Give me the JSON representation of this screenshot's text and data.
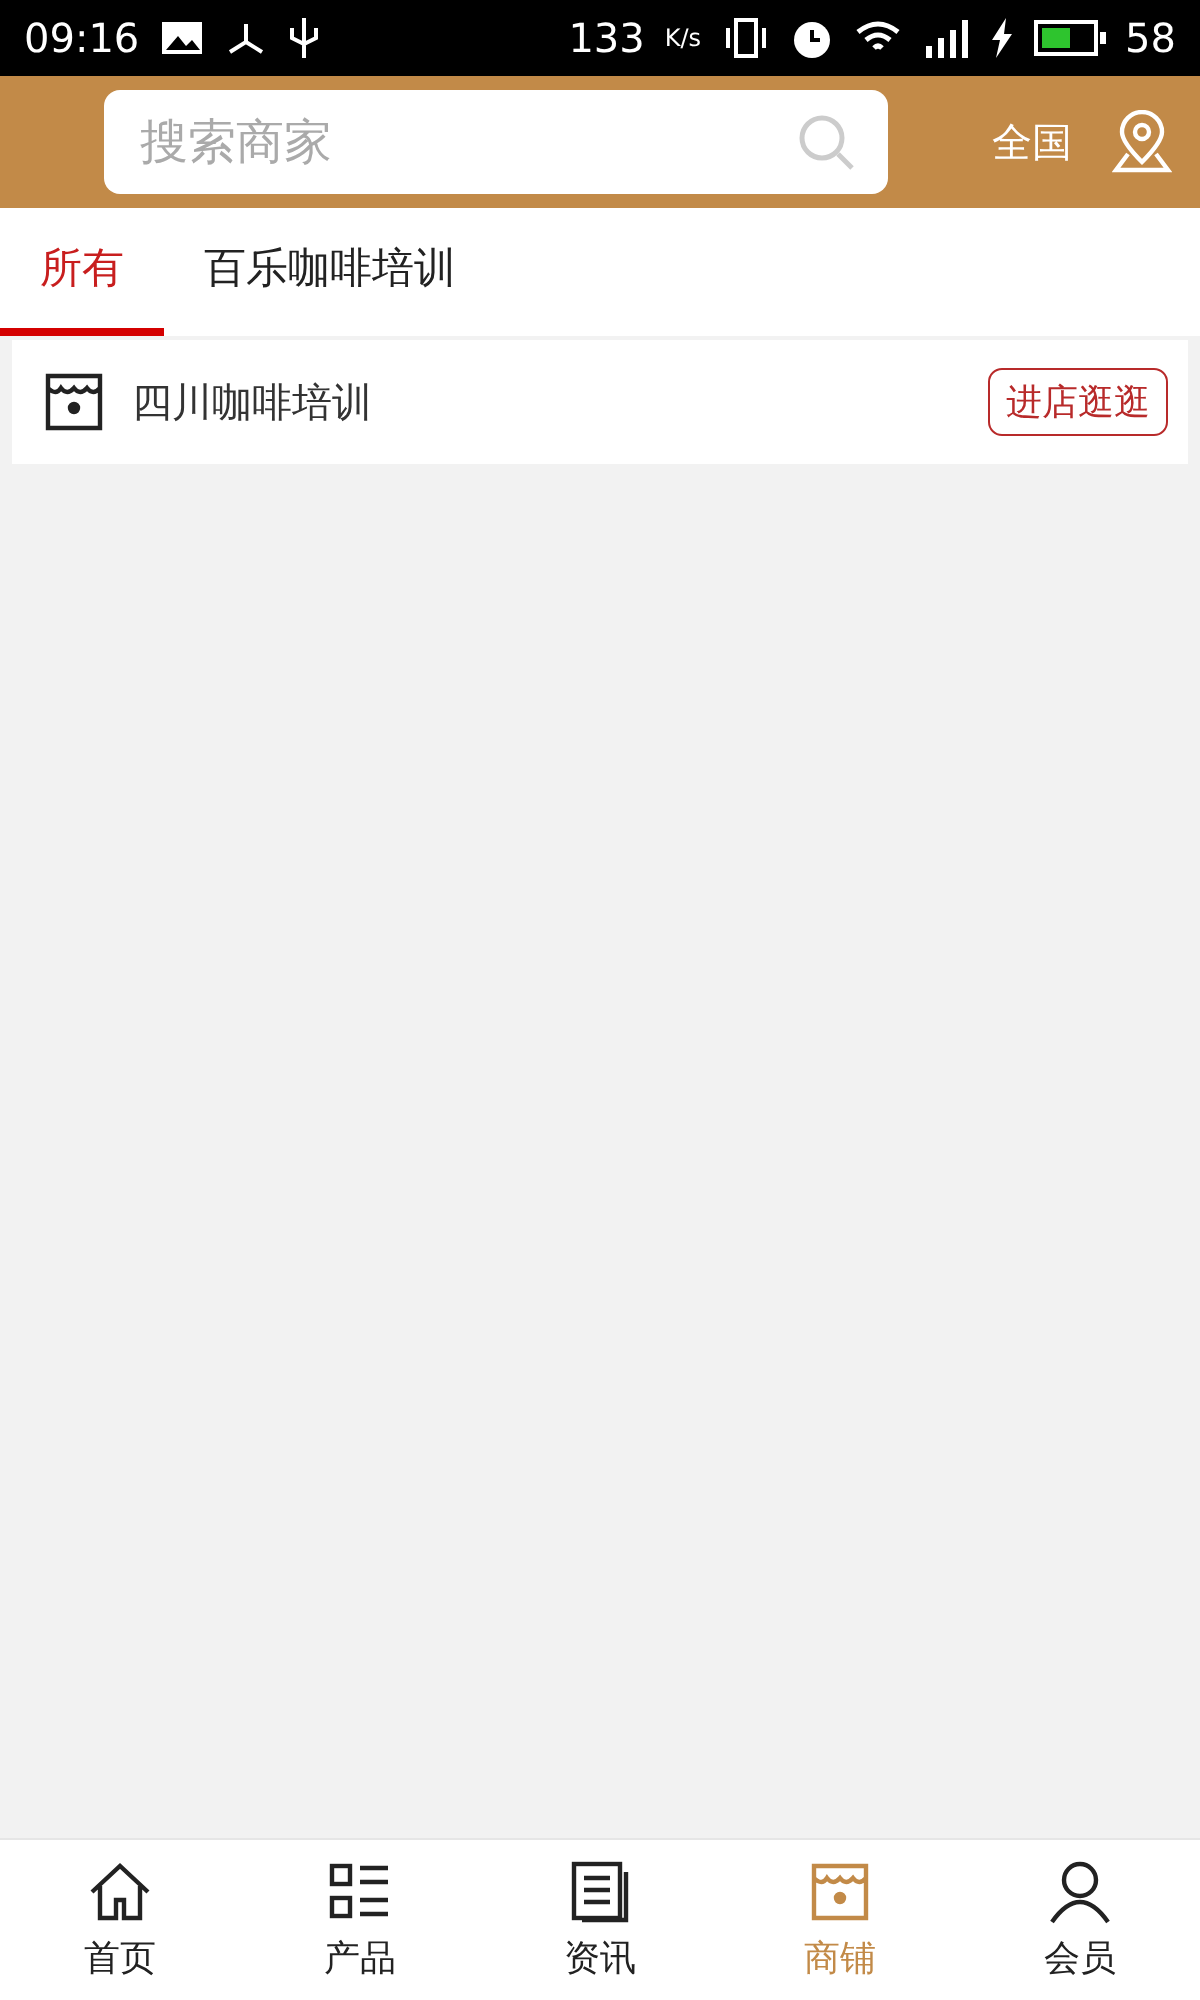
{
  "status_bar": {
    "time": "09:16",
    "speed": "133",
    "speed_unit": "K/s",
    "battery": "58"
  },
  "header": {
    "search": {
      "placeholder": "搜索商家"
    },
    "region": "全国"
  },
  "tabs": [
    {
      "label": "所有",
      "selected": true
    },
    {
      "label": "百乐咖啡培训",
      "selected": false
    }
  ],
  "shops": [
    {
      "name": "四川咖啡培训",
      "action": "进店逛逛"
    }
  ],
  "bottom_nav": [
    {
      "kind": "home",
      "label": "首页",
      "selected": false
    },
    {
      "kind": "list",
      "label": "产品",
      "selected": false
    },
    {
      "kind": "news",
      "label": "资讯",
      "selected": false
    },
    {
      "kind": "store",
      "label": "商铺",
      "selected": true
    },
    {
      "kind": "user",
      "label": "会员",
      "selected": false
    }
  ]
}
